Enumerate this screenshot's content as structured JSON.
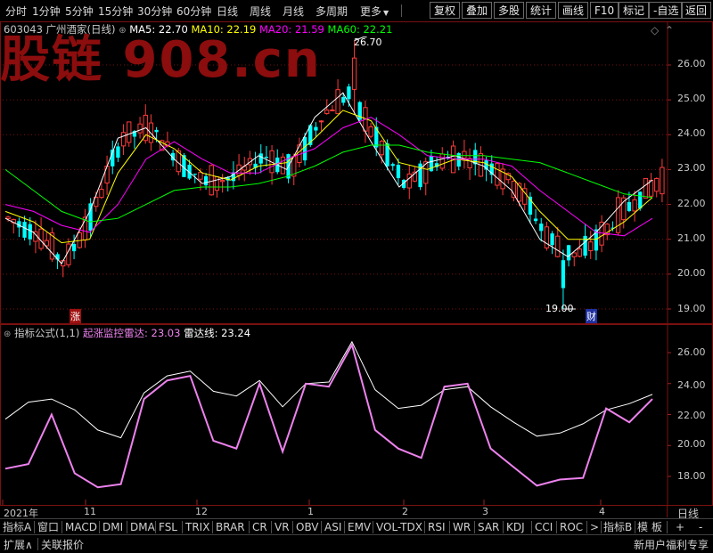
{
  "toolbar": {
    "periods": [
      "分时",
      "1分钟",
      "5分钟",
      "15分钟",
      "30分钟",
      "60分钟",
      "日线",
      "周线",
      "月线",
      "多周期",
      "更多"
    ],
    "more_arrow": "▼",
    "buttons": [
      "复权",
      "叠加",
      "多股",
      "统计",
      "画线",
      "F10",
      "标记",
      "-自选",
      "返回"
    ]
  },
  "watermark": "股链 908.cn",
  "main_chart": {
    "stock_code": "603043",
    "stock_name": "广州酒家(日线)",
    "ma5_label": "MA5: 22.70",
    "ma10_label": "MA10: 22.19",
    "ma20_label": "MA20: 21.59",
    "ma60_label": "MA60: 22.21",
    "high_marker": "26.70",
    "low_marker": "19.00",
    "badge_zhang": "涨",
    "badge_cai": "财",
    "price_ticks": [
      "26.00",
      "25.00",
      "24.00",
      "23.00",
      "22.00",
      "21.00",
      "20.00",
      "19.00"
    ],
    "colors": {
      "ma5": "#ffffff",
      "ma10": "#ffff00",
      "ma20": "#ff00ff",
      "ma60": "#00ff00",
      "up": "#ff3b3b",
      "down": "#00ffff"
    }
  },
  "indicator_chart": {
    "formula_label": "指标公式(1,1)",
    "line1_label": "起涨监控雷达: 23.03",
    "line2_label": "雷达线: 23.24",
    "ticks": [
      "26.00",
      "24.00",
      "22.00",
      "20.00",
      "18.00"
    ],
    "colors": {
      "line1": "#ee82ee",
      "line2": "#ffffff"
    }
  },
  "time_axis": {
    "labels": [
      "2021年",
      "11",
      "12",
      "1",
      "2",
      "3",
      "4"
    ],
    "period_label": "日线"
  },
  "tabs": [
    "指标A",
    "窗口",
    "MACD",
    "DMI",
    "DMA",
    "FSL",
    "TRIX",
    "BRAR",
    "CR",
    "VR",
    "OBV",
    "ASI",
    "EMV",
    "VOL-TDX",
    "RSI",
    "WR",
    "SAR",
    "KDJ",
    "CCI",
    "ROC",
    ">",
    "指标B",
    "模",
    "板",
    "+",
    "-"
  ],
  "status": {
    "expand": "扩展∧",
    "related": "关联报价",
    "right": "新用户福利专享"
  },
  "chart_data": {
    "type": "line",
    "title": "广州酒家(日线)",
    "x": [
      "2021年",
      "11",
      "12",
      "1",
      "2",
      "3",
      "4"
    ],
    "ylim": [
      18.8,
      26.9
    ],
    "series": [
      {
        "name": "MA5",
        "values": [
          21.6,
          21.2,
          20.3,
          21.8,
          23.9,
          24.2,
          23.3,
          22.6,
          22.8,
          23.4,
          23.0,
          24.5,
          25.2,
          23.8,
          22.5,
          23.2,
          23.4,
          23.1,
          22.4,
          21.0,
          20.5,
          21.2,
          22.1,
          22.7
        ]
      },
      {
        "name": "MA10",
        "values": [
          21.8,
          21.5,
          20.9,
          21.0,
          22.9,
          24.0,
          23.6,
          22.9,
          22.7,
          23.1,
          23.2,
          23.9,
          24.7,
          24.4,
          23.2,
          23.0,
          23.3,
          23.2,
          22.8,
          21.8,
          21.0,
          21.0,
          21.5,
          22.2
        ]
      },
      {
        "name": "MA20",
        "values": [
          22.0,
          21.8,
          21.4,
          21.2,
          22.0,
          23.3,
          23.8,
          23.3,
          22.9,
          22.9,
          23.3,
          23.6,
          24.2,
          24.5,
          24.0,
          23.4,
          23.3,
          23.3,
          23.1,
          22.4,
          21.8,
          21.2,
          21.1,
          21.6
        ]
      },
      {
        "name": "MA60",
        "values": [
          23.0,
          22.4,
          21.8,
          21.5,
          21.6,
          22.0,
          22.4,
          22.5,
          22.5,
          22.6,
          22.8,
          23.1,
          23.5,
          23.7,
          23.7,
          23.5,
          23.4,
          23.4,
          23.3,
          23.2,
          22.9,
          22.6,
          22.3,
          22.2
        ]
      }
    ],
    "indicator": {
      "ylim": [
        16.8,
        27.2
      ],
      "series": [
        {
          "name": "起涨监控雷达",
          "values": [
            18.5,
            18.8,
            22.0,
            18.2,
            17.3,
            17.5,
            23.0,
            24.2,
            24.5,
            20.3,
            19.8,
            24.0,
            19.6,
            24.0,
            23.8,
            26.5,
            21.0,
            19.8,
            19.2,
            23.8,
            24.0,
            19.8,
            18.6,
            17.4,
            17.8,
            17.9,
            22.4,
            21.5,
            23.0
          ]
        },
        {
          "name": "雷达线",
          "values": [
            21.7,
            22.8,
            23.0,
            22.3,
            21.0,
            20.5,
            23.4,
            24.5,
            24.8,
            23.5,
            23.2,
            24.2,
            22.5,
            24.0,
            24.1,
            26.7,
            23.6,
            22.4,
            22.6,
            23.6,
            23.8,
            22.5,
            21.5,
            20.6,
            20.8,
            21.4,
            22.3,
            22.7,
            23.3
          ]
        }
      ]
    }
  }
}
